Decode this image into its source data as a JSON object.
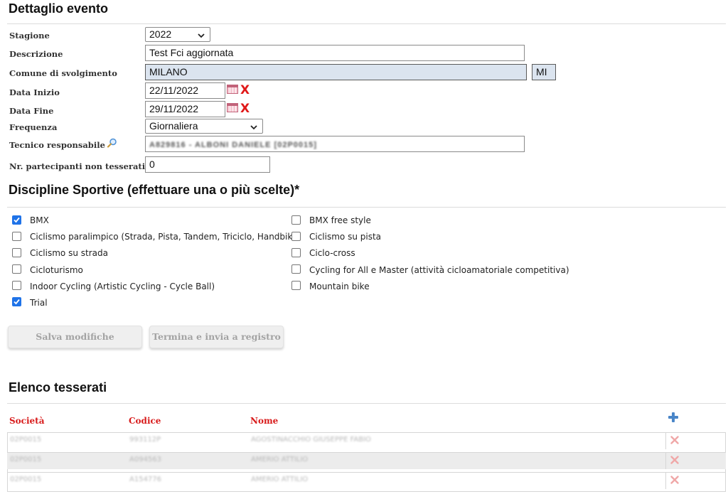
{
  "event_detail": {
    "title": "Dettaglio evento",
    "fields": {
      "stagione": {
        "label": "Stagione",
        "value": "2022"
      },
      "descrizione": {
        "label": "Descrizione",
        "value": "Test Fci aggiornata"
      },
      "comune": {
        "label": "Comune di svolgimento",
        "value": "MILANO",
        "province": "MI"
      },
      "data_inizio": {
        "label": "Data Inizio",
        "value": "22/11/2022",
        "clear": "X"
      },
      "data_fine": {
        "label": "Data Fine",
        "value": "29/11/2022",
        "clear": "X"
      },
      "frequenza": {
        "label": "Frequenza",
        "value": "Giornaliera"
      },
      "tecnico": {
        "label": "Tecnico responsabile",
        "value": "A829816 - ALBONI DANIELE [02P0015]"
      },
      "partecipanti": {
        "label": "Nr. partecipanti non tesserati",
        "value": "0"
      }
    }
  },
  "disciplines": {
    "title": "Discipline Sportive (effettuare una o più scelte)*",
    "left": [
      {
        "label": "BMX",
        "checked": true
      },
      {
        "label": "Ciclismo paralimpico (Strada, Pista, Tandem, Triciclo, Handbike)",
        "checked": false
      },
      {
        "label": "Ciclismo su strada",
        "checked": false
      },
      {
        "label": "Cicloturismo",
        "checked": false
      },
      {
        "label": "Indoor Cycling (Artistic Cycling - Cycle Ball)",
        "checked": false
      },
      {
        "label": "Trial",
        "checked": true
      }
    ],
    "right": [
      {
        "label": "BMX free style",
        "checked": false
      },
      {
        "label": "Ciclismo su pista",
        "checked": false
      },
      {
        "label": "Ciclo-cross",
        "checked": false
      },
      {
        "label": "Cycling for All e Master (attività cicloamatoriale competitiva)",
        "checked": false
      },
      {
        "label": "Mountain bike",
        "checked": false
      }
    ]
  },
  "actions": {
    "save": "Salva modifiche",
    "submit": "Termina e invia a registro"
  },
  "members": {
    "title": "Elenco tesserati",
    "columns": [
      "Società",
      "Codice",
      "Nome"
    ],
    "rows": [
      {
        "societa": "02P0015",
        "codice": "993112P",
        "nome": "AGOSTINACCHIO GIUSEPPE FABIO"
      },
      {
        "societa": "02P0015",
        "codice": "A094563",
        "nome": "AMERIO ATTILIO"
      },
      {
        "societa": "02P0015",
        "codice": "A154776",
        "nome": "AMERIO ATTILIO"
      }
    ]
  },
  "colors": {
    "header_red": "#d81b1b",
    "checkbox_blue": "#1f73e8",
    "comune_bg": "#dbe4ef"
  },
  "icons": [
    "search-icon",
    "calendar-icon",
    "clear-x-icon",
    "chevron-down-icon",
    "add-plus-icon",
    "delete-x-icon"
  ]
}
